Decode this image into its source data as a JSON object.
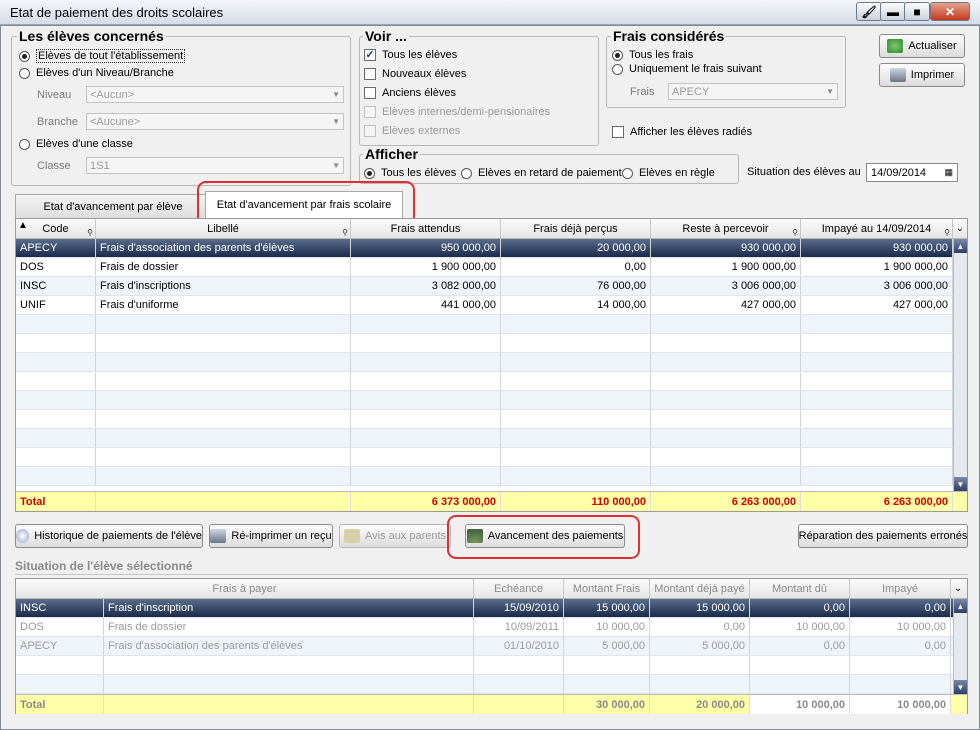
{
  "window": {
    "title": "Etat de paiement des droits scolaires",
    "buttons": {
      "minimize": "▬",
      "maximize": "■",
      "close": "✕"
    }
  },
  "eleves": {
    "title": "Les élèves concernés",
    "opt_all": "Elèves de tout l'établissement",
    "opt_niveau": "Elèves d'un Niveau/Branche",
    "niveau_label": "Niveau",
    "niveau_value": "<Aucun>",
    "branche_label": "Branche",
    "branche_value": "<Aucune>",
    "opt_classe": "Elèves d'une classe",
    "classe_label": "Classe",
    "classe_value": "1S1"
  },
  "voir": {
    "title": "Voir ...",
    "items": [
      "Tous les élèves",
      "Nouveaux élèves",
      "Anciens élèves",
      "Elèves internes/demi-pensionaires",
      "Elèves externes"
    ],
    "checked": [
      true,
      false,
      false,
      false,
      false
    ],
    "disabled": [
      false,
      false,
      false,
      true,
      true
    ]
  },
  "frais": {
    "title": "Frais considérés",
    "opt_all": "Tous les frais",
    "opt_one": "Uniquement le frais suivant",
    "frais_label": "Frais",
    "frais_value": "APECY"
  },
  "afficher_radies": "Afficher les élèves radiés",
  "afficher": {
    "title": "Afficher",
    "opt1": "Tous les élèves",
    "opt2": "Elèves en retard de paiement",
    "opt3": "Elèves en règle"
  },
  "situation": {
    "label": "Situation des élèves au",
    "date": "14/09/2014"
  },
  "buttons": {
    "actualiser": "Actualiser",
    "imprimer": "Imprimer"
  },
  "tabs": [
    "Etat d'avancement par élève",
    "Etat d'avancement par frais scolaire"
  ],
  "grid1": {
    "headers": [
      "Code",
      "Libellé",
      "Frais attendus",
      "Frais déjà perçus",
      "Reste à percevoir",
      "Impayé au 14/09/2014"
    ],
    "rows": [
      [
        "APECY",
        "Frais d'association des parents d'élèves",
        "950 000,00",
        "20 000,00",
        "930 000,00",
        "930 000,00"
      ],
      [
        "DOS",
        "Frais de dossier",
        "1 900 000,00",
        "0,00",
        "1 900 000,00",
        "1 900 000,00"
      ],
      [
        "INSC",
        "Frais d'inscriptions",
        "3 082 000,00",
        "76 000,00",
        "3 006 000,00",
        "3 006 000,00"
      ],
      [
        "UNIF",
        "Frais d'uniforme",
        "441 000,00",
        "14 000,00",
        "427 000,00",
        "427 000,00"
      ]
    ],
    "total": [
      "Total",
      "",
      "6 373 000,00",
      "110 000,00",
      "6 263 000,00",
      "6 263 000,00"
    ]
  },
  "actions": {
    "historique": "Historique de paiements de l'élève",
    "reimprimer": "Ré-imprimer un reçu",
    "avis": "Avis aux parents",
    "avancement": "Avancement des paiements",
    "reparation": "Réparation des paiements erronés"
  },
  "section2_title": "Situation de l'élève sélectionné",
  "grid2": {
    "headers": [
      "Frais à payer",
      "Echéance",
      "Montant Frais",
      "Montant déjà payé",
      "Montant dû",
      "Impayé"
    ],
    "rows": [
      [
        "INSC",
        "Frais d'inscription",
        "15/09/2010",
        "15 000,00",
        "15 000,00",
        "0,00",
        "0,00"
      ],
      [
        "DOS",
        "Frais de dossier",
        "10/09/2011",
        "10 000,00",
        "0,00",
        "10 000,00",
        "10 000,00"
      ],
      [
        "APECY",
        "Frais d'association des parents d'élèves",
        "01/10/2010",
        "5 000,00",
        "5 000,00",
        "0,00",
        "0,00"
      ]
    ],
    "total": [
      "Total",
      "",
      "",
      "30 000,00",
      "20 000,00",
      "10 000,00",
      "10 000,00"
    ]
  }
}
